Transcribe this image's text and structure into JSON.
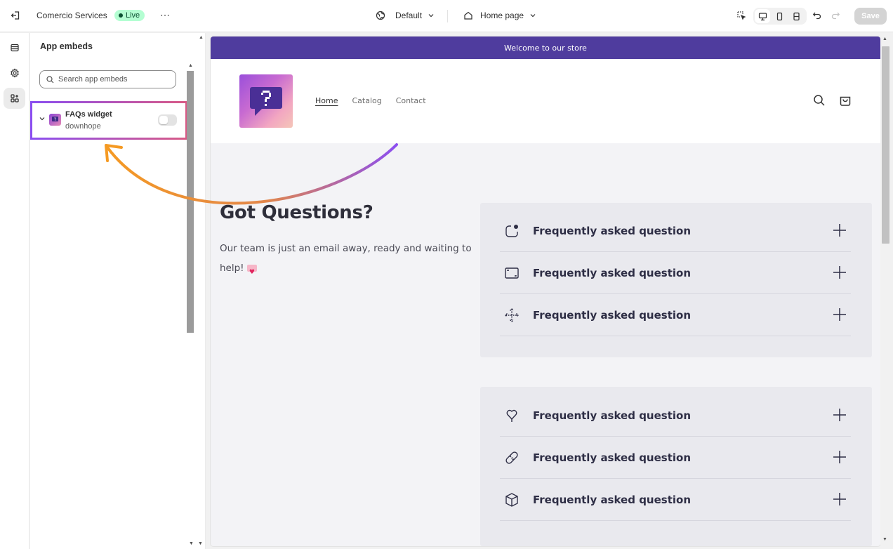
{
  "topbar": {
    "exit_icon": "exit-icon",
    "store_name": "Comercio Services",
    "live_badge": "Live",
    "more_label": "⋯",
    "theme_label": "Default",
    "page_label": "Home page",
    "save_label": "Save"
  },
  "panel": {
    "title": "App embeds",
    "search_placeholder": "Search app embeds",
    "embed": {
      "name": "FAQs widget",
      "developer": "downhope",
      "enabled": false
    }
  },
  "preview": {
    "announcement": "Welcome to our store",
    "nav": [
      "Home",
      "Catalog",
      "Contact"
    ],
    "faq_heading": "Got Questions?",
    "faq_subtext": "Our team is just an email away, ready and waiting to help!",
    "faq_groups": [
      {
        "items": [
          {
            "icon": "chat-bubble-icon",
            "question": "Frequently asked question"
          },
          {
            "icon": "frame-icon",
            "question": "Frequently asked question"
          },
          {
            "icon": "move-arrows-icon",
            "question": "Frequently asked question"
          }
        ]
      },
      {
        "items": [
          {
            "icon": "heart-pin-icon",
            "question": "Frequently asked question"
          },
          {
            "icon": "bandage-icon",
            "question": "Frequently asked question"
          },
          {
            "icon": "box-icon",
            "question": "Frequently asked question"
          }
        ]
      }
    ]
  },
  "colors": {
    "announcement_bg": "#4f3c9e",
    "highlight_gradient_start": "#8b4ef0",
    "highlight_gradient_end": "#d85a86",
    "arrow_orange": "#f59a23",
    "arrow_purple": "#8b4ef0",
    "live_badge_bg": "#b4fed2"
  }
}
